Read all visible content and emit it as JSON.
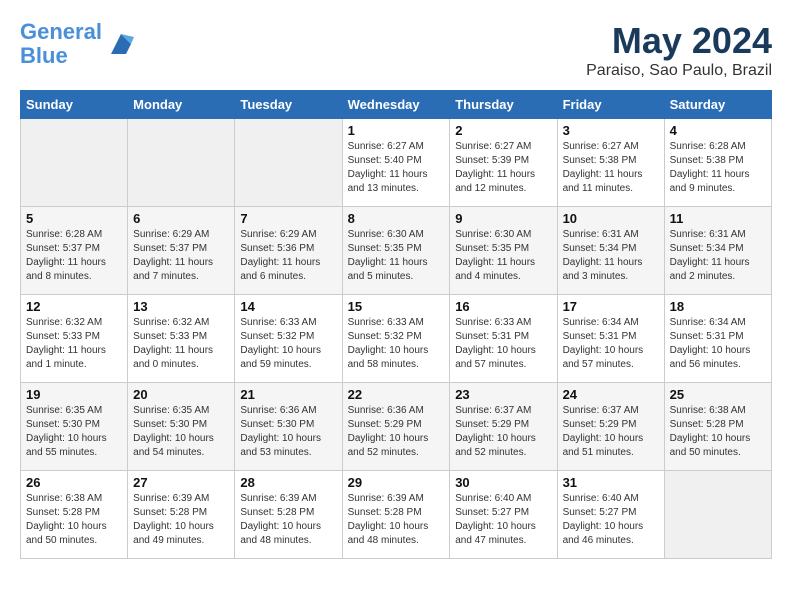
{
  "header": {
    "logo_line1": "General",
    "logo_line2": "Blue",
    "month": "May 2024",
    "location": "Paraiso, Sao Paulo, Brazil"
  },
  "days_of_week": [
    "Sunday",
    "Monday",
    "Tuesday",
    "Wednesday",
    "Thursday",
    "Friday",
    "Saturday"
  ],
  "weeks": [
    [
      {
        "day": "",
        "info": ""
      },
      {
        "day": "",
        "info": ""
      },
      {
        "day": "",
        "info": ""
      },
      {
        "day": "1",
        "info": "Sunrise: 6:27 AM\nSunset: 5:40 PM\nDaylight: 11 hours\nand 13 minutes."
      },
      {
        "day": "2",
        "info": "Sunrise: 6:27 AM\nSunset: 5:39 PM\nDaylight: 11 hours\nand 12 minutes."
      },
      {
        "day": "3",
        "info": "Sunrise: 6:27 AM\nSunset: 5:38 PM\nDaylight: 11 hours\nand 11 minutes."
      },
      {
        "day": "4",
        "info": "Sunrise: 6:28 AM\nSunset: 5:38 PM\nDaylight: 11 hours\nand 9 minutes."
      }
    ],
    [
      {
        "day": "5",
        "info": "Sunrise: 6:28 AM\nSunset: 5:37 PM\nDaylight: 11 hours\nand 8 minutes."
      },
      {
        "day": "6",
        "info": "Sunrise: 6:29 AM\nSunset: 5:37 PM\nDaylight: 11 hours\nand 7 minutes."
      },
      {
        "day": "7",
        "info": "Sunrise: 6:29 AM\nSunset: 5:36 PM\nDaylight: 11 hours\nand 6 minutes."
      },
      {
        "day": "8",
        "info": "Sunrise: 6:30 AM\nSunset: 5:35 PM\nDaylight: 11 hours\nand 5 minutes."
      },
      {
        "day": "9",
        "info": "Sunrise: 6:30 AM\nSunset: 5:35 PM\nDaylight: 11 hours\nand 4 minutes."
      },
      {
        "day": "10",
        "info": "Sunrise: 6:31 AM\nSunset: 5:34 PM\nDaylight: 11 hours\nand 3 minutes."
      },
      {
        "day": "11",
        "info": "Sunrise: 6:31 AM\nSunset: 5:34 PM\nDaylight: 11 hours\nand 2 minutes."
      }
    ],
    [
      {
        "day": "12",
        "info": "Sunrise: 6:32 AM\nSunset: 5:33 PM\nDaylight: 11 hours\nand 1 minute."
      },
      {
        "day": "13",
        "info": "Sunrise: 6:32 AM\nSunset: 5:33 PM\nDaylight: 11 hours\nand 0 minutes."
      },
      {
        "day": "14",
        "info": "Sunrise: 6:33 AM\nSunset: 5:32 PM\nDaylight: 10 hours\nand 59 minutes."
      },
      {
        "day": "15",
        "info": "Sunrise: 6:33 AM\nSunset: 5:32 PM\nDaylight: 10 hours\nand 58 minutes."
      },
      {
        "day": "16",
        "info": "Sunrise: 6:33 AM\nSunset: 5:31 PM\nDaylight: 10 hours\nand 57 minutes."
      },
      {
        "day": "17",
        "info": "Sunrise: 6:34 AM\nSunset: 5:31 PM\nDaylight: 10 hours\nand 57 minutes."
      },
      {
        "day": "18",
        "info": "Sunrise: 6:34 AM\nSunset: 5:31 PM\nDaylight: 10 hours\nand 56 minutes."
      }
    ],
    [
      {
        "day": "19",
        "info": "Sunrise: 6:35 AM\nSunset: 5:30 PM\nDaylight: 10 hours\nand 55 minutes."
      },
      {
        "day": "20",
        "info": "Sunrise: 6:35 AM\nSunset: 5:30 PM\nDaylight: 10 hours\nand 54 minutes."
      },
      {
        "day": "21",
        "info": "Sunrise: 6:36 AM\nSunset: 5:30 PM\nDaylight: 10 hours\nand 53 minutes."
      },
      {
        "day": "22",
        "info": "Sunrise: 6:36 AM\nSunset: 5:29 PM\nDaylight: 10 hours\nand 52 minutes."
      },
      {
        "day": "23",
        "info": "Sunrise: 6:37 AM\nSunset: 5:29 PM\nDaylight: 10 hours\nand 52 minutes."
      },
      {
        "day": "24",
        "info": "Sunrise: 6:37 AM\nSunset: 5:29 PM\nDaylight: 10 hours\nand 51 minutes."
      },
      {
        "day": "25",
        "info": "Sunrise: 6:38 AM\nSunset: 5:28 PM\nDaylight: 10 hours\nand 50 minutes."
      }
    ],
    [
      {
        "day": "26",
        "info": "Sunrise: 6:38 AM\nSunset: 5:28 PM\nDaylight: 10 hours\nand 50 minutes."
      },
      {
        "day": "27",
        "info": "Sunrise: 6:39 AM\nSunset: 5:28 PM\nDaylight: 10 hours\nand 49 minutes."
      },
      {
        "day": "28",
        "info": "Sunrise: 6:39 AM\nSunset: 5:28 PM\nDaylight: 10 hours\nand 48 minutes."
      },
      {
        "day": "29",
        "info": "Sunrise: 6:39 AM\nSunset: 5:28 PM\nDaylight: 10 hours\nand 48 minutes."
      },
      {
        "day": "30",
        "info": "Sunrise: 6:40 AM\nSunset: 5:27 PM\nDaylight: 10 hours\nand 47 minutes."
      },
      {
        "day": "31",
        "info": "Sunrise: 6:40 AM\nSunset: 5:27 PM\nDaylight: 10 hours\nand 46 minutes."
      },
      {
        "day": "",
        "info": ""
      }
    ]
  ]
}
